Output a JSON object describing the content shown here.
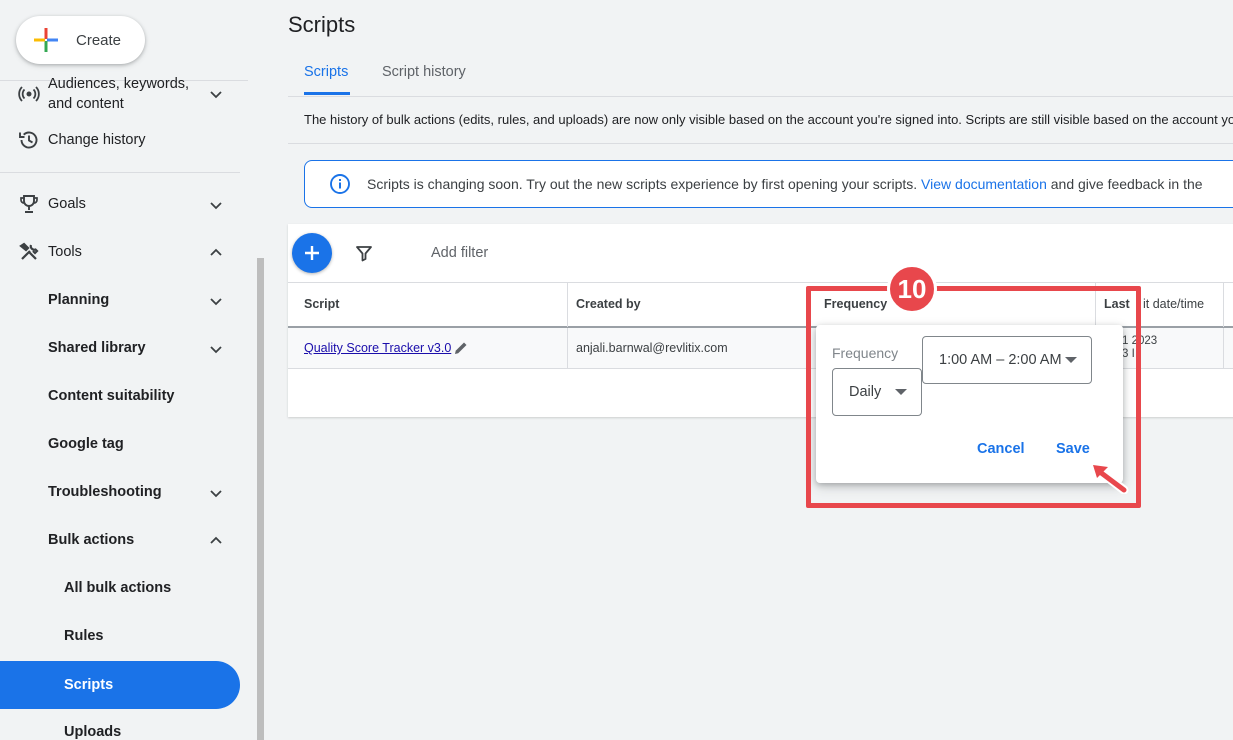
{
  "sidebar": {
    "create_label": "Create",
    "items": [
      {
        "label": "Audiences, keywords,",
        "label2": "and content",
        "icon": "broadcast-icon",
        "chevron": "down"
      },
      {
        "label": "Change history",
        "icon": "history-icon"
      },
      {
        "label": "Goals",
        "icon": "trophy-icon",
        "chevron": "down"
      },
      {
        "label": "Tools",
        "icon": "tools-icon",
        "chevron": "up"
      },
      {
        "label": "Planning",
        "chevron": "down"
      },
      {
        "label": "Shared library",
        "chevron": "down"
      },
      {
        "label": "Content suitability"
      },
      {
        "label": "Google tag"
      },
      {
        "label": "Troubleshooting",
        "chevron": "down"
      },
      {
        "label": "Bulk actions",
        "chevron": "up"
      },
      {
        "label": "All bulk actions"
      },
      {
        "label": "Rules"
      },
      {
        "label": "Scripts",
        "active": true
      },
      {
        "label": "Uploads"
      }
    ]
  },
  "main": {
    "title": "Scripts",
    "tabs": [
      {
        "label": "Scripts",
        "active": true
      },
      {
        "label": "Script history"
      }
    ],
    "notice": "The history of bulk actions (edits, rules, and uploads) are now only visible based on the account you're signed into. Scripts are still visible based on the account yo",
    "banner": {
      "text_before": "Scripts is changing soon. Try out the new scripts experience by first opening your scripts.",
      "link": "View documentation",
      "text_after": "and give feedback in the"
    },
    "toolbar": {
      "add_filter": "Add filter"
    },
    "table": {
      "headers": [
        "Script",
        "Created by",
        "Frequency",
        "Last",
        "it date/time"
      ],
      "rows": [
        {
          "script": "Quality Score Tracker v3.0",
          "created_by": "anjali.barnwal@revlitix.com",
          "last_run_line1": "1 2023",
          "last_run_line2": "3 I"
        }
      ]
    }
  },
  "popup": {
    "frequency_label": "Frequency",
    "frequency_value": "Daily",
    "time_value": "1:00 AM – 2:00 AM",
    "cancel_label": "Cancel",
    "save_label": "Save"
  },
  "annotation": {
    "step_number": "10",
    "color": "#e8474c"
  },
  "colors": {
    "accent": "#1a73e8",
    "annotation": "#e8474c"
  }
}
